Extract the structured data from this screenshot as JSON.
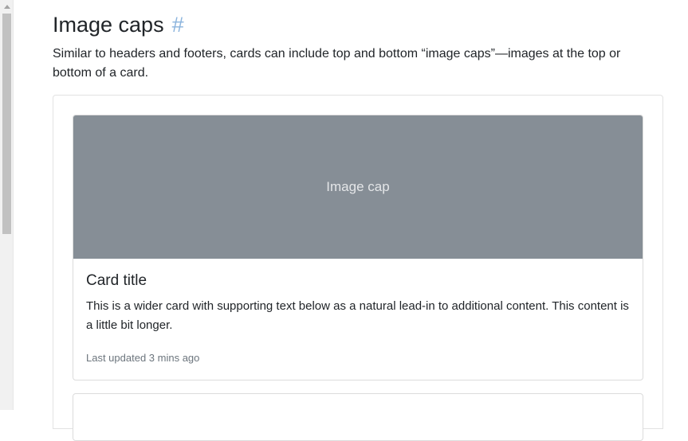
{
  "section": {
    "title": "Image caps",
    "anchor": "#",
    "description": "Similar to headers and footers, cards can include top and bottom “image caps”—images at the top or bottom of a card."
  },
  "card": {
    "image_cap_label": "Image cap",
    "title": "Card title",
    "text": "This is a wider card with supporting text below as a natural lead-in to additional content. This content is a little bit longer.",
    "updated": "Last updated 3 mins ago"
  },
  "colors": {
    "image_cap_bg": "#868e96",
    "anchor": "#8bb4dd",
    "muted_text": "#6c757d"
  }
}
